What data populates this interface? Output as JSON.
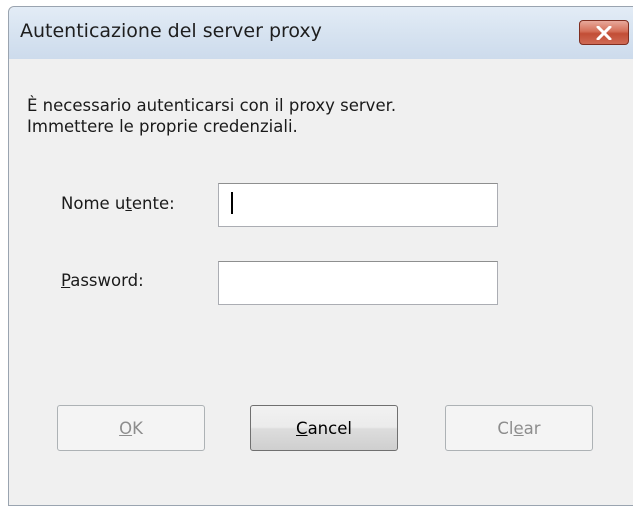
{
  "window": {
    "title": "Autenticazione del server proxy",
    "close_icon": "close-icon"
  },
  "message": {
    "line1": "È necessario autenticarsi con il proxy server.",
    "line2": "Immettere le proprie credenziali."
  },
  "username": {
    "label_pre": "Nome u",
    "label_mnemonic": "t",
    "label_post": "ente:",
    "value": ""
  },
  "password": {
    "label_pre": "",
    "label_mnemonic": "P",
    "label_post": "assword:",
    "value": ""
  },
  "buttons": {
    "ok": {
      "pre": "",
      "mnemonic": "O",
      "post": "K",
      "enabled": false
    },
    "cancel": {
      "pre": "",
      "mnemonic": "C",
      "post": "ancel",
      "enabled": true
    },
    "clear": {
      "pre": "Cl",
      "mnemonic": "e",
      "post": "ar",
      "enabled": false
    }
  },
  "colors": {
    "titlebar": "#d8e4f1",
    "close_button": "#c24e36",
    "dialog_background": "#f0f0f0",
    "disabled_text": "#8d8d8d"
  }
}
